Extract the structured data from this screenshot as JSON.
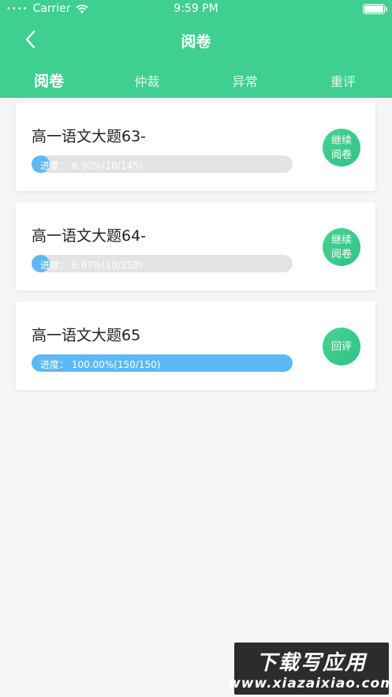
{
  "status_bar": {
    "dots": "••••",
    "carrier": "Carrier",
    "time": "9:59 PM"
  },
  "nav": {
    "title": "阅卷"
  },
  "tabs": [
    {
      "label": "阅卷",
      "active": true
    },
    {
      "label": "仲裁",
      "active": false
    },
    {
      "label": "异常",
      "active": false
    },
    {
      "label": "重评",
      "active": false
    }
  ],
  "cards": [
    {
      "title": "高一语文大题63-",
      "progress_text": "进度：  6.90%(10/145)",
      "progress": 0.069,
      "action_label": "继续阅卷"
    },
    {
      "title": "高一语文大题64-",
      "progress_text": "进度：  6.67%(10/150)",
      "progress": 0.0667,
      "action_label": "继续阅卷"
    },
    {
      "title": "高一语文大题65",
      "progress_text": "进度：  100.00%(150/150)",
      "progress": 1.0,
      "action_label": "回评"
    }
  ],
  "watermark": {
    "logo": "下载写应用",
    "url": "www.xiazaixiao.com"
  },
  "colors": {
    "primary": "#3ecf91",
    "progress": "#5db8f6",
    "track": "#e3e3e3"
  }
}
